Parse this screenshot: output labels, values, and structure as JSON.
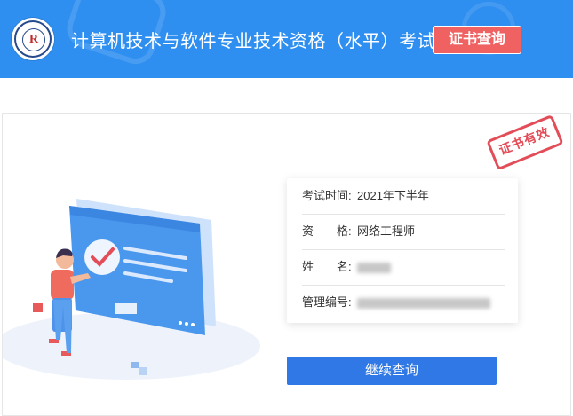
{
  "header": {
    "title": "计算机技术与软件专业技术资格（水平）考试",
    "cert_query_label": "证书查询",
    "logo_icon": "exam-seal-logo-icon"
  },
  "result": {
    "exam_time_label": "考试时间:",
    "exam_time_value": "2021年下半年",
    "qualification_label": "资　　格:",
    "qualification_value": "网络工程师",
    "name_label": "姓　　名:",
    "cert_no_label": "管理编号:",
    "stamp_text": "证书有效"
  },
  "actions": {
    "continue_label": "继续查询"
  },
  "colors": {
    "header_bg": "#2f8ff0",
    "cert_button_bg": "#f06262",
    "continue_button_bg": "#2f78e6",
    "stamp": "#e34d58"
  }
}
